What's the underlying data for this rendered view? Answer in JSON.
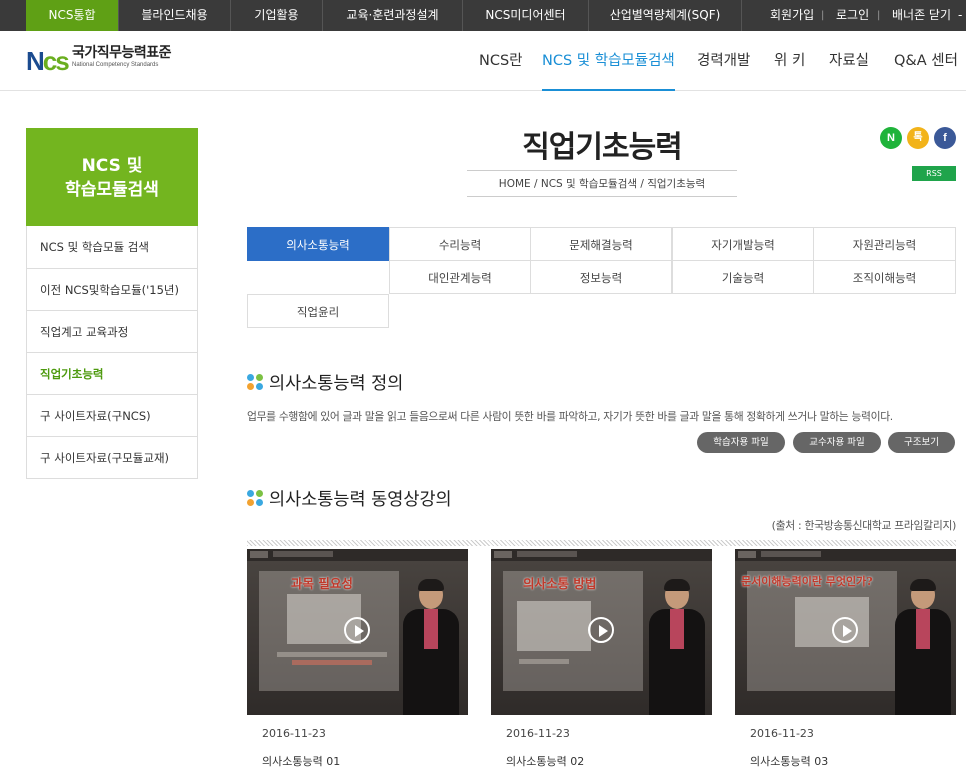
{
  "topbar": {
    "tabs": [
      "NCS통합",
      "블라인드채용",
      "기업활용",
      "교육·훈련과정설계",
      "NCS미디어센터",
      "산업별역량체계(SQF)"
    ],
    "links": [
      "회원가입",
      "로그인",
      "배너존 닫기"
    ],
    "banner_suffix": "-"
  },
  "header": {
    "logo_mark_n": "N",
    "logo_mark_cs": "cs",
    "logo_title": "국가직무능력표준",
    "logo_subtitle": "National Competency Standards",
    "nav": [
      "NCS란",
      "NCS 및 학습모듈검색",
      "경력개발",
      "위 키",
      "자료실",
      "Q&A 센터"
    ]
  },
  "sidebar": {
    "head_line1": "NCS 및",
    "head_line2": "학습모듈검색",
    "items": [
      "NCS 및 학습모듈 검색",
      "이전 NCS및학습모듈('15년)",
      "직업계고 교육과정",
      "직업기초능력",
      "구 사이트자료(구NCS)",
      "구 사이트자료(구모듈교재)"
    ]
  },
  "page": {
    "title": "직업기초능력",
    "breadcrumb": "HOME / NCS 및 학습모듈검색 / 직업기초능력",
    "sns": [
      "N",
      "톡",
      "f"
    ],
    "rss": "RSS"
  },
  "tabs": {
    "row1": [
      "의사소통능력",
      "수리능력",
      "문제해결능력",
      "자기개발능력",
      "자원관리능력"
    ],
    "row2": [
      "대인관계능력",
      "정보능력",
      "기술능력",
      "조직이해능력"
    ],
    "row3": [
      "직업윤리"
    ]
  },
  "definition": {
    "heading": "의사소통능력 정의",
    "text": "업무를 수행함에 있어 글과 말을 읽고 들음으로써 다른 사람이 뜻한 바를 파악하고, 자기가 뜻한 바를 글과 말을 통해 정확하게 쓰거나 말하는 능력이다.",
    "buttons": [
      "학습자용 파일",
      "교수자용 파일",
      "구조보기"
    ]
  },
  "videos": {
    "heading": "의사소통능력 동영상강의",
    "source": "(출처 : 한국방송통신대학교 프라임칼리지)",
    "items": [
      {
        "slide_title": "과목 필요성",
        "date": "2016-11-23",
        "title": "의사소통능력 01"
      },
      {
        "slide_title": "의사소통 방법",
        "date": "2016-11-23",
        "title": "의사소통능력 02"
      },
      {
        "slide_title": "문서이해능력이란 무엇인가?",
        "date": "2016-11-23",
        "title": "의사소통능력 03"
      }
    ]
  },
  "colors": {
    "brand_green": "#73b51f",
    "active_tab_blue": "#2c6ec7",
    "nav_active": "#1a8fd6",
    "topbar_bg": "#3a3a3a"
  }
}
